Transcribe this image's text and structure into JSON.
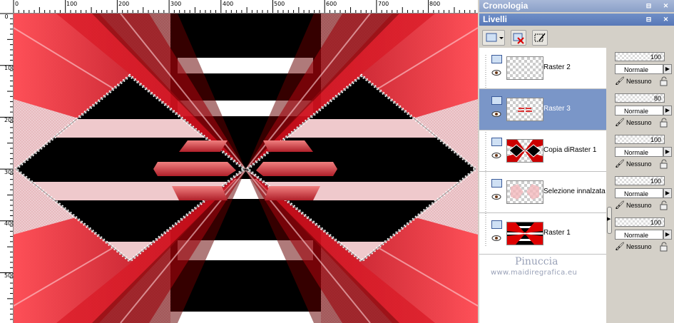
{
  "ruler": {
    "top_labels": [
      "0",
      "100",
      "200",
      "300",
      "400",
      "500",
      "600",
      "700",
      "800"
    ],
    "left_labels": [
      "0",
      "100",
      "200",
      "300",
      "400",
      "500"
    ]
  },
  "palette": {
    "history_title": "Cronologia",
    "layers_title": "Livelli"
  },
  "layers": [
    {
      "name": "Raster 2",
      "opacity": "100",
      "blend": "Normale",
      "mask": "Nessuno",
      "selected": false
    },
    {
      "name": "Raster 3",
      "opacity": "80",
      "blend": "Normale",
      "mask": "Nessuno",
      "selected": true
    },
    {
      "name": "Copia diRaster 1",
      "opacity": "100",
      "blend": "Normale",
      "mask": "Nessuno",
      "selected": false
    },
    {
      "name": "Selezione innalzata",
      "opacity": "100",
      "blend": "Normale",
      "mask": "Nessuno",
      "selected": false
    },
    {
      "name": "Raster 1",
      "opacity": "100",
      "blend": "Normale",
      "mask": "Nessuno",
      "selected": false
    }
  ],
  "watermark": {
    "name": "Pinuccia",
    "url": "www.maidiregrafica.eu"
  },
  "colors": {
    "accent_red": "#e0101a",
    "selected_row": "#7a96c8",
    "title_bar": "#5878b8"
  }
}
